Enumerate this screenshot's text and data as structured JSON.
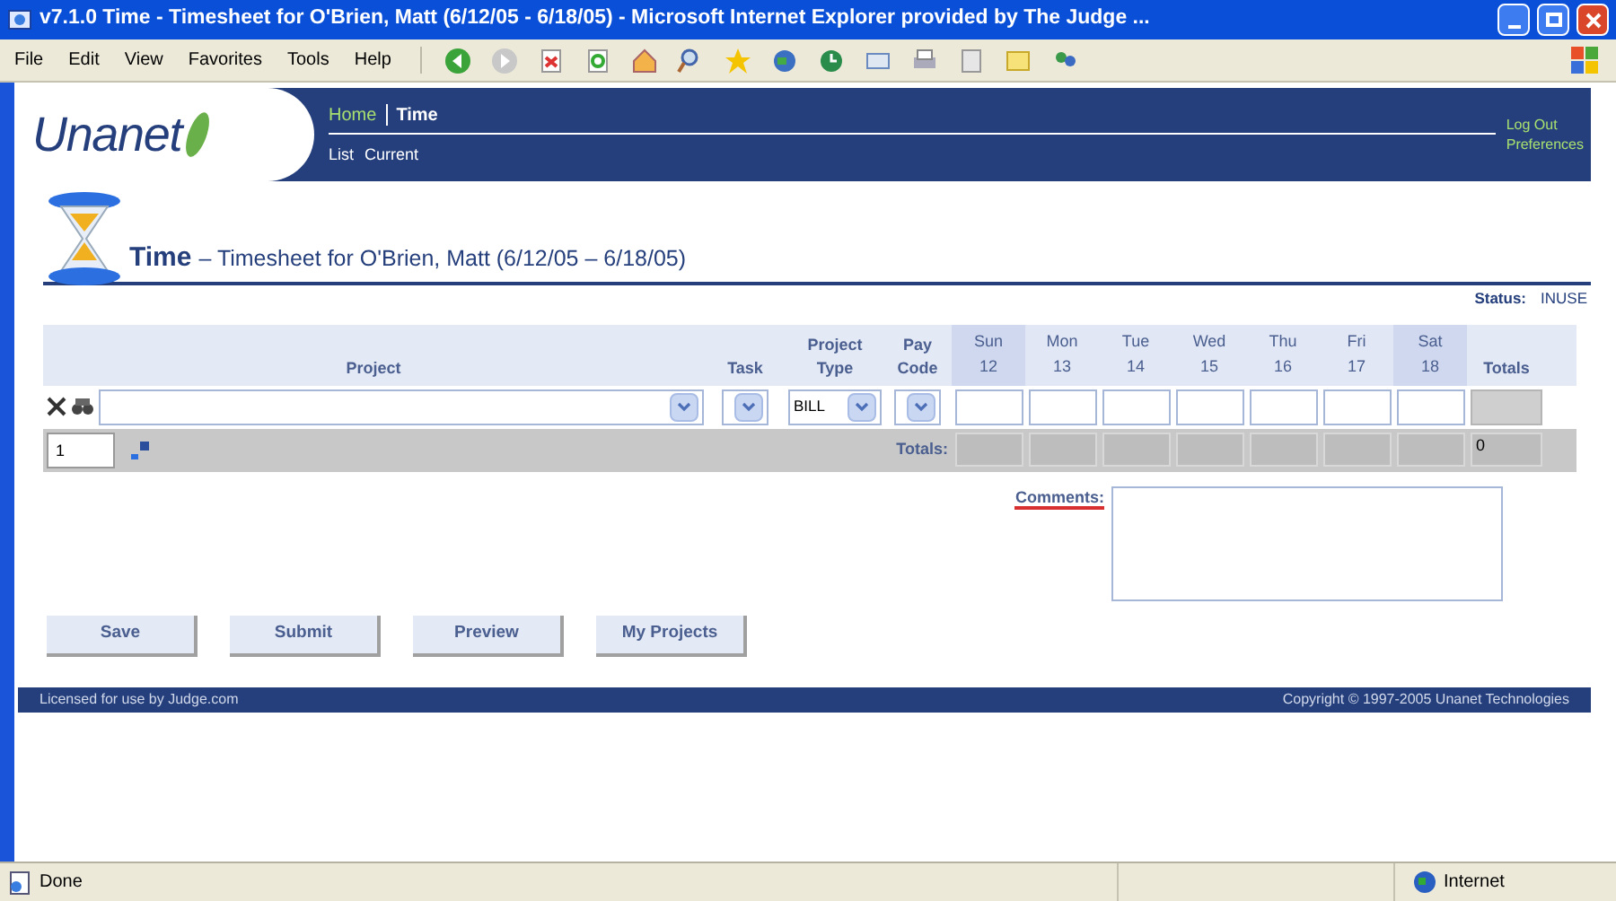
{
  "window": {
    "title": "v7.1.0 Time - Timesheet for O'Brien, Matt (6/12/05 - 6/18/05) - Microsoft Internet Explorer provided by The Judge ..."
  },
  "menu": [
    "File",
    "Edit",
    "View",
    "Favorites",
    "Tools",
    "Help"
  ],
  "header": {
    "logo": "Unanet",
    "nav": [
      {
        "label": "Home",
        "selected": false
      },
      {
        "label": "Time",
        "selected": true
      }
    ],
    "subnav": [
      "List",
      "Current"
    ],
    "links": [
      "Log Out",
      "Preferences"
    ]
  },
  "page_title": {
    "title": "Time",
    "subtitle": "– Timesheet for O'Brien, Matt (6/12/05 – 6/18/05)"
  },
  "status": {
    "label": "Status:",
    "value": "INUSE"
  },
  "grid": {
    "columns": [
      {
        "label": "Project"
      },
      {
        "label": "Task"
      },
      {
        "label": "Project Type"
      },
      {
        "label": "Pay Code"
      }
    ],
    "days": [
      {
        "name": "Sun",
        "date": "12",
        "weekend": true
      },
      {
        "name": "Mon",
        "date": "13",
        "weekend": false
      },
      {
        "name": "Tue",
        "date": "14",
        "weekend": false
      },
      {
        "name": "Wed",
        "date": "15",
        "weekend": false
      },
      {
        "name": "Thu",
        "date": "16",
        "weekend": false
      },
      {
        "name": "Fri",
        "date": "17",
        "weekend": false
      },
      {
        "name": "Sat",
        "date": "18",
        "weekend": true
      }
    ],
    "totals_header": "Totals",
    "project_type": "BILL",
    "row_count": "1",
    "totals_label": "Totals:",
    "grand_total": "0"
  },
  "comments": {
    "label": "Comments:"
  },
  "buttons": [
    "Save",
    "Submit",
    "Preview",
    "My Projects"
  ],
  "footer": {
    "left": "Licensed for use by Judge.com",
    "right": "Copyright © 1997-2005 Unanet Technologies"
  },
  "status_bar": {
    "text": "Done",
    "zone": "Internet"
  }
}
